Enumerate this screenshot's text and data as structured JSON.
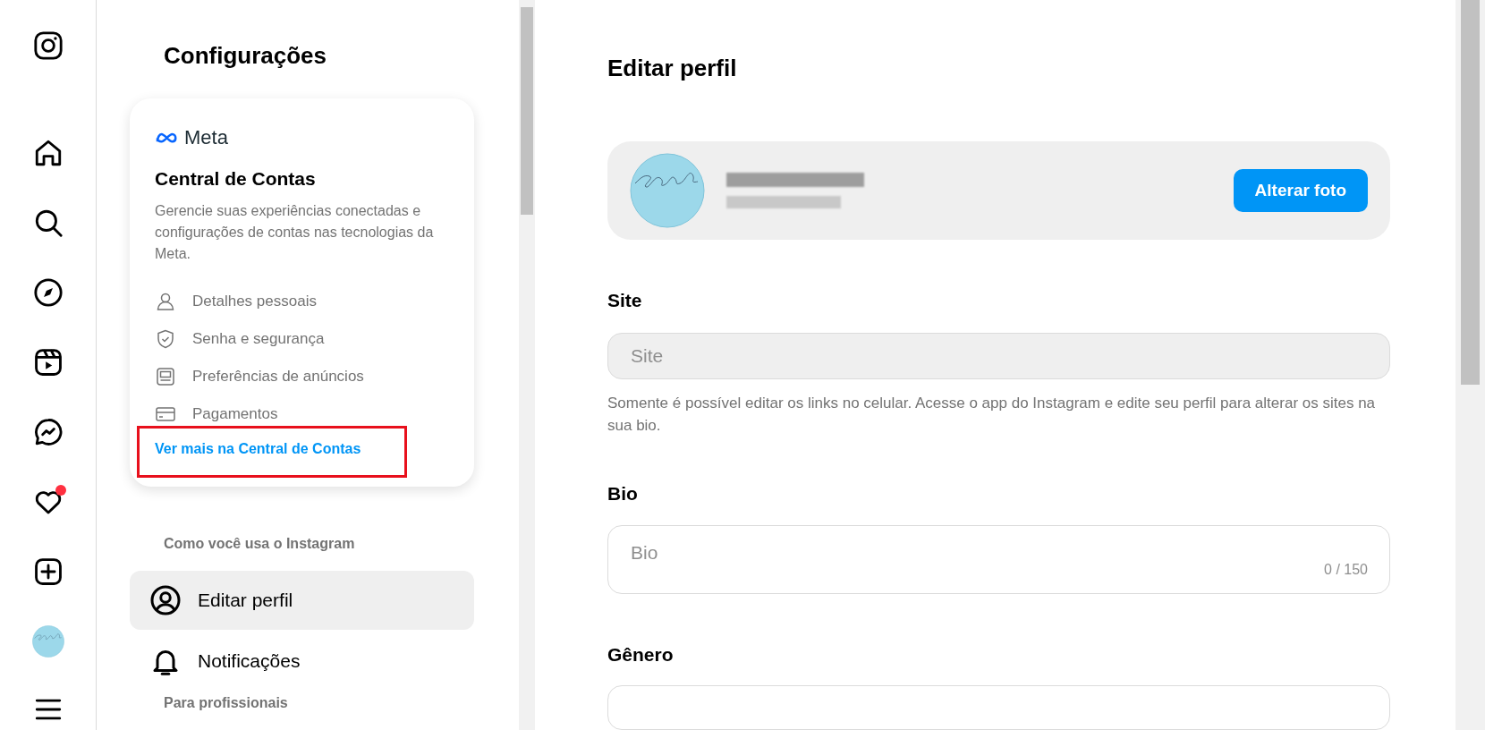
{
  "nav": [
    {
      "kind": "logo"
    },
    {
      "kind": "home"
    },
    {
      "kind": "search"
    },
    {
      "kind": "explore"
    },
    {
      "kind": "reels"
    },
    {
      "kind": "messages"
    },
    {
      "kind": "notifications",
      "badge": true
    },
    {
      "kind": "create"
    },
    {
      "kind": "avatar"
    },
    {
      "kind": "menu"
    }
  ],
  "settings": {
    "title": "Configurações",
    "accounts_card": {
      "brand": "Meta",
      "title": "Central de Contas",
      "description": "Gerencie suas experiências conectadas e configurações de contas nas tecnologias da Meta.",
      "items": [
        {
          "kind": "person",
          "label": "Detalhes pessoais"
        },
        {
          "kind": "shield",
          "label": "Senha e segurança"
        },
        {
          "kind": "ads",
          "label": "Preferências de anúncios"
        },
        {
          "kind": "card",
          "label": "Pagamentos"
        }
      ],
      "link": {
        "label": "Ver mais na Central de Contas",
        "highlighted": true
      }
    },
    "sections": [
      {
        "heading": "Como você usa o Instagram",
        "items": [
          {
            "kind": "profile",
            "label": "Editar perfil",
            "selected": true
          },
          {
            "kind": "bell",
            "label": "Notificações",
            "selected": false
          }
        ]
      },
      {
        "heading": "Para profissionais"
      }
    ]
  },
  "main": {
    "title": "Editar perfil",
    "profile": {
      "button": "Alterar foto"
    },
    "site": {
      "label": "Site",
      "placeholder": "Site",
      "help": "Somente é possível editar os links no celular. Acesse o app do Instagram e edite seu perfil para alterar os sites na sua bio."
    },
    "bio": {
      "label": "Bio",
      "placeholder": "Bio",
      "counter": "0 / 150"
    },
    "gender": {
      "label": "Gênero"
    }
  }
}
